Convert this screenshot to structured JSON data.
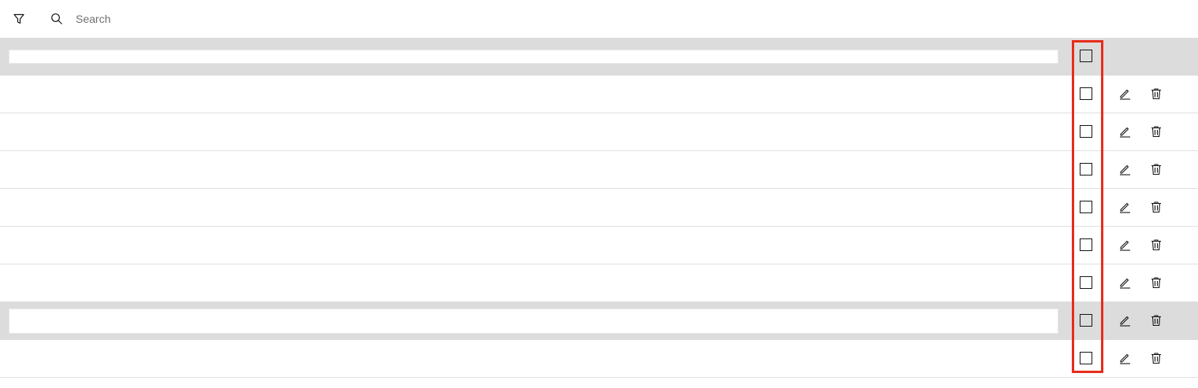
{
  "toolbar": {
    "filter_icon": "filter-icon",
    "search_icon": "search-icon",
    "search_placeholder": "Search",
    "search_value": ""
  },
  "table": {
    "rows": [
      {
        "type": "header-edit",
        "checked": false,
        "actions": false
      },
      {
        "type": "data",
        "checked": false,
        "actions": true
      },
      {
        "type": "data",
        "checked": false,
        "actions": true
      },
      {
        "type": "data",
        "checked": false,
        "actions": true
      },
      {
        "type": "data",
        "checked": false,
        "actions": true
      },
      {
        "type": "data",
        "checked": false,
        "actions": true
      },
      {
        "type": "data",
        "checked": false,
        "actions": true
      },
      {
        "type": "editing",
        "checked": false,
        "actions": true
      },
      {
        "type": "data",
        "checked": false,
        "actions": true
      }
    ],
    "edit_icon": "edit-icon",
    "delete_icon": "trash-icon"
  },
  "colors": {
    "shaded_row": "#dcdcdc",
    "row_border": "#e0e0e0",
    "highlight": "#e82c1b",
    "icon": "#161616"
  }
}
